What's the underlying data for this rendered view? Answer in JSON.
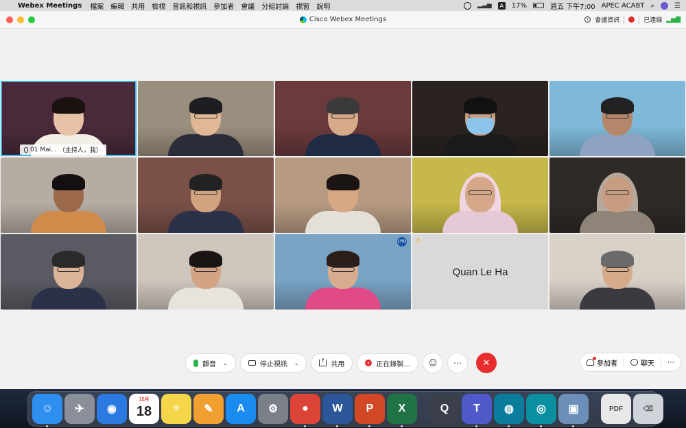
{
  "menubar": {
    "app_name": "Webex Meetings",
    "items": [
      "檔案",
      "編輯",
      "共用",
      "檢視",
      "音訊和視訊",
      "參加者",
      "會議",
      "分組討論",
      "視窗",
      "說明"
    ],
    "battery": "17%",
    "clock": "週五 下午7:00",
    "user": "APEC ACABT",
    "input_badge": "A"
  },
  "window": {
    "title": "Cisco Webex Meetings",
    "meeting_info": "會議資訊",
    "connected": "已連線"
  },
  "tiles": [
    {
      "name": "01 Mai...",
      "role": "（主持人，我）",
      "bg": "#4a2a3a",
      "skin": "#e8c2a8",
      "hair": "#1b1210",
      "shirt": "#f3efe6",
      "active": true
    },
    {
      "bg": "#9a8e7e",
      "skin": "#e0b896",
      "hair": "#1e1e22",
      "shirt": "#2a2d38",
      "glasses": true
    },
    {
      "bg": "#6a3a3c",
      "skin": "#d6a989",
      "hair": "#3a3a3a",
      "shirt": "#1f2a44",
      "glasses": true
    },
    {
      "bg": "#2a2320",
      "skin": "#c9a085",
      "hair": "#111",
      "shirt": "#1a1a1a",
      "glasses": true,
      "mask": true
    },
    {
      "bg": "#7fb8d9",
      "skin": "#b4876a",
      "hair": "#222",
      "shirt": "#8ea3c2",
      "glasses": true
    },
    {
      "bg": "#b5aca3",
      "skin": "#9c6a4b",
      "hair": "#151010",
      "shirt": "#d08a4a"
    },
    {
      "bg": "#7a5048",
      "skin": "#d2a37f",
      "hair": "#222",
      "shirt": "#2b3148",
      "glasses": true
    },
    {
      "bg": "#b79a82",
      "skin": "#d8a884",
      "hair": "#1a1412",
      "shirt": "#e4dfd8"
    },
    {
      "bg": "#c7b84a",
      "skin": "#d6a88a",
      "hijab": "#efd6e2",
      "shirt": "#e6c9d6",
      "glasses": true
    },
    {
      "bg": "#2f2a26",
      "skin": "#c79c80",
      "hijab": "#b6a89c",
      "shirt": "#8f8478",
      "glasses": true
    },
    {
      "bg": "#5a5a62",
      "skin": "#dcb598",
      "hair": "#2a2a2a",
      "shirt": "#2a3148",
      "glasses": true
    },
    {
      "bg": "#cfc6bd",
      "skin": "#d3a384",
      "hair": "#1a1412",
      "shirt": "#e8e4dc",
      "glasses": true
    },
    {
      "bg": "#7aa3c4",
      "skin": "#d8ad8f",
      "hair": "#2a1e18",
      "shirt": "#e04a86",
      "glasses": true,
      "badge": "LHU"
    },
    {
      "name": "Quan Le Ha",
      "placeholder": true
    },
    {
      "bg": "#d8d1c8",
      "skin": "#d6ab8c",
      "hair": "#6a6a6a",
      "shirt": "#3a3a40",
      "glasses": true
    }
  ],
  "controls": {
    "mute": "靜音",
    "stop_video": "停止視訊",
    "share": "共用",
    "recording": "正在錄製...",
    "participants": "參加者",
    "chat": "聊天",
    "more": "⋯",
    "end": "✕"
  },
  "dock": {
    "calendar_month": "12月",
    "calendar_day": "18",
    "apps": [
      {
        "name": "finder",
        "color": "#2f8ff0",
        "glyph": "☺"
      },
      {
        "name": "launchpad",
        "color": "#8a8f99",
        "glyph": "✈"
      },
      {
        "name": "safari",
        "color": "#2a7ae2",
        "glyph": "◉"
      },
      {
        "name": "calendar",
        "color": "#ffffff",
        "glyph": ""
      },
      {
        "name": "notes",
        "color": "#f5d64a",
        "glyph": "≡"
      },
      {
        "name": "pages",
        "color": "#f0a030",
        "glyph": "✎"
      },
      {
        "name": "app-store",
        "color": "#1a8cf0",
        "glyph": "A"
      },
      {
        "name": "system-preferences",
        "color": "#7b7f88",
        "glyph": "⚙"
      },
      {
        "name": "chrome",
        "color": "#db4437",
        "glyph": "●"
      },
      {
        "name": "word",
        "color": "#2b579a",
        "glyph": "W"
      },
      {
        "name": "powerpoint",
        "color": "#d24726",
        "glyph": "P"
      },
      {
        "name": "excel",
        "color": "#217346",
        "glyph": "X"
      },
      {
        "name": "quicktime",
        "color": "#3a3f4a",
        "glyph": "Q"
      },
      {
        "name": "teams",
        "color": "#5059c9",
        "glyph": "T"
      },
      {
        "name": "webex",
        "color": "#0a7d9c",
        "glyph": "◍"
      },
      {
        "name": "webex-meetings",
        "color": "#0a8fa0",
        "glyph": "◎"
      },
      {
        "name": "preview",
        "color": "#6b8fb8",
        "glyph": "▣"
      },
      {
        "name": "pdf-document",
        "color": "#e8e8e8",
        "glyph": "PDF"
      },
      {
        "name": "trash",
        "color": "#cfd4da",
        "glyph": "⌫"
      }
    ]
  }
}
